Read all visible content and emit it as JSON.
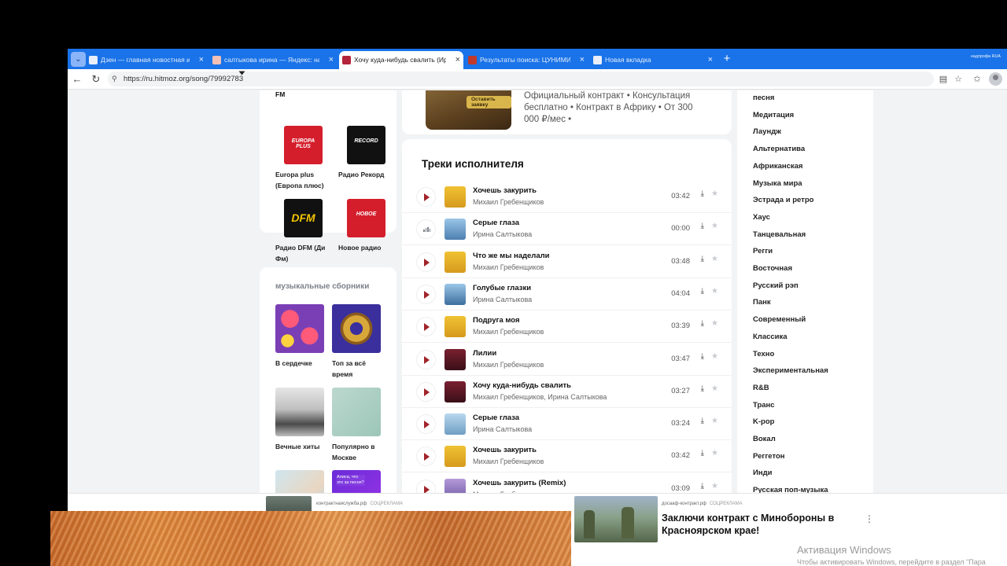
{
  "browser": {
    "tabs": [
      {
        "title": "Дзен — главная новостная инфо",
        "favicon_color": "#e9eef8"
      },
      {
        "title": "салтыкова ирина — Яндекс: нашл",
        "favicon_color": "#f3c0b8"
      },
      {
        "title": "Хочу куда-нибудь свалить (Ирин",
        "favicon_color": "#b3243a"
      },
      {
        "title": "Результаты поиска: ЦУНИМИ",
        "favicon_color": "#c0392b"
      },
      {
        "title": "Новая вкладка",
        "favicon_color": "#e9eef8"
      }
    ],
    "profile_label": "надпрофа  RUA",
    "url": "https://ru.hitmoz.org/song/79992783"
  },
  "radio": {
    "partial_label": "FM",
    "stations": [
      {
        "label": "Europa plus (Европа плюс)",
        "cover_text": "EUROPA PLUS",
        "bg": "#d41e2c"
      },
      {
        "label": "Радио Рекорд",
        "cover_text": "RECORD",
        "bg": "#111111"
      },
      {
        "label": "Радио DFM (Ди Фм)",
        "cover_text": "DFM",
        "bg": "#111111"
      },
      {
        "label": "Новое радио",
        "cover_text": "НОВОЕ",
        "bg": "#d41e2c"
      }
    ]
  },
  "collections": {
    "title": "музыкальные сборники",
    "items": [
      {
        "label": "В сердечке"
      },
      {
        "label": "Топ за всё время"
      },
      {
        "label": "Вечные хиты"
      },
      {
        "label": "Популярно в Москве"
      },
      {
        "label": ""
      },
      {
        "label": "",
        "cover_text": "Алиса, что это за песня?"
      }
    ]
  },
  "ad": {
    "button_label": "Оставить заявку",
    "text": "Официальный контракт • Консультация бесплатно • Контракт в Африку • От 300 000 ₽/мес •"
  },
  "tracks": {
    "title": "Треки исполнителя",
    "items": [
      {
        "title": "Хочешь закурить",
        "artist": "Михаил Гребенщиков",
        "duration": "03:42",
        "playing": false
      },
      {
        "title": "Серые глаза",
        "artist": "Ирина Салтыкова",
        "duration": "00:00",
        "playing": true
      },
      {
        "title": "Что же мы наделали",
        "artist": "Михаил Гребенщиков",
        "duration": "03:48",
        "playing": false
      },
      {
        "title": "Голубые глазки",
        "artist": "Ирина Салтыкова",
        "duration": "04:04",
        "playing": false
      },
      {
        "title": "Подруга моя",
        "artist": "Михаил Гребенщиков",
        "duration": "03:39",
        "playing": false
      },
      {
        "title": "Лилии",
        "artist": "Михаил Гребенщиков",
        "duration": "03:47",
        "playing": false
      },
      {
        "title": "Хочу куда-нибудь свалить",
        "artist": "Михаил Гребенщиков, Ирина Салтыкова",
        "duration": "03:27",
        "playing": false
      },
      {
        "title": "Серые глаза",
        "artist": "Ирина Салтыкова",
        "duration": "03:24",
        "playing": false
      },
      {
        "title": "Хочешь закурить",
        "artist": "Михаил Гребенщиков",
        "duration": "03:42",
        "playing": false
      },
      {
        "title": "Хочешь закурить (Remix)",
        "artist": "Михаил Гребенщиков",
        "duration": "03:09",
        "playing": false
      }
    ]
  },
  "genres": [
    "песня",
    "Медитация",
    "Лаундж",
    "Альтернатива",
    "Африканская",
    "Музыка мира",
    "Эстрада и ретро",
    "Хаус",
    "Танцевальная",
    "Регги",
    "Восточная",
    "Русский рэп",
    "Панк",
    "Современный",
    "Классика",
    "Техно",
    "Экспериментальная",
    "R&B",
    "Транс",
    "K-pop",
    "Вокал",
    "Реггетон",
    "Инди",
    "Русская поп-музыка"
  ],
  "banner": {
    "left_source": "контрактнаяслужба.рф",
    "left_tag": "СОЦРЕКЛАМА",
    "right_source": "досааф-контракт.рф",
    "right_tag": "СОЦРЕКЛАМА",
    "right_title": "Заключи контракт с Минобороны в Красноярском крае!"
  },
  "windows": {
    "activation_title": "Активация Windows",
    "activation_text": "Чтобы активировать Windows, перейдите в раздел \"Пара"
  }
}
